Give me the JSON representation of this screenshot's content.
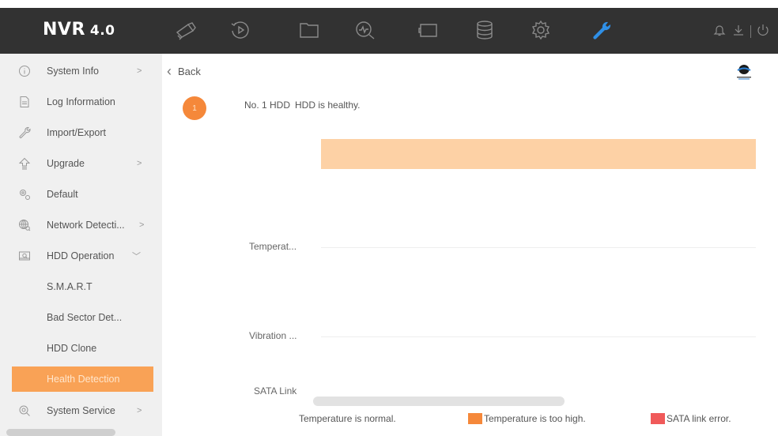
{
  "app": {
    "name": "NVR",
    "version": "4.0"
  },
  "top_nav": [
    {
      "icon": "live-view-camera-icon"
    },
    {
      "icon": "playback-icon"
    },
    {
      "icon": "file-folder-icon"
    },
    {
      "icon": "smart-analysis-icon"
    },
    {
      "icon": "camera-management-icon"
    },
    {
      "icon": "storage-icon"
    },
    {
      "icon": "settings-gear-icon"
    },
    {
      "icon": "maintenance-wrench-icon",
      "active": true
    }
  ],
  "top_right": [
    "notification-bell-icon",
    "download-icon",
    "power-icon"
  ],
  "sidebar": {
    "items": [
      {
        "label": "System Info",
        "arrow": ">",
        "icon": "info-circle-icon"
      },
      {
        "label": "Log Information",
        "icon": "log-document-icon"
      },
      {
        "label": "Import/Export",
        "icon": "import-export-wrench-icon"
      },
      {
        "label": "Upgrade",
        "arrow": ">",
        "icon": "upgrade-arrow-icon"
      },
      {
        "label": "Default",
        "icon": "default-gears-icon"
      },
      {
        "label": "Network Detecti...",
        "arrow": ">",
        "icon": "network-globe-icon"
      },
      {
        "label": "HDD Operation",
        "arrow": "﹀",
        "icon": "hdd-operation-icon"
      },
      {
        "label": "S.M.A.R.T"
      },
      {
        "label": "Bad Sector Det..."
      },
      {
        "label": "HDD Clone"
      },
      {
        "label": "Health Detection",
        "active": true
      },
      {
        "label": "System Service",
        "arrow": ">",
        "icon": "system-service-icon"
      }
    ]
  },
  "main": {
    "back_label": "Back",
    "hdd_number": "1",
    "hdd_status_no": "No. 1 HDD",
    "hdd_status_text": "HDD is healthy.",
    "rows": {
      "temperature": "Temperat...",
      "vibration": "Vibration ...",
      "sata_link": "SATA Link"
    },
    "legend": [
      {
        "label": "Temperature is normal.",
        "color": ""
      },
      {
        "label": "Temperature is too high.",
        "color": "#f5883a"
      },
      {
        "label": "SATA link error.",
        "color": "#f05a5a"
      }
    ]
  },
  "colors": {
    "accent": "#f9a256",
    "topbar": "#323232",
    "temperature_band": "#fdd1a5",
    "active_tool": "#2f8fe6"
  }
}
